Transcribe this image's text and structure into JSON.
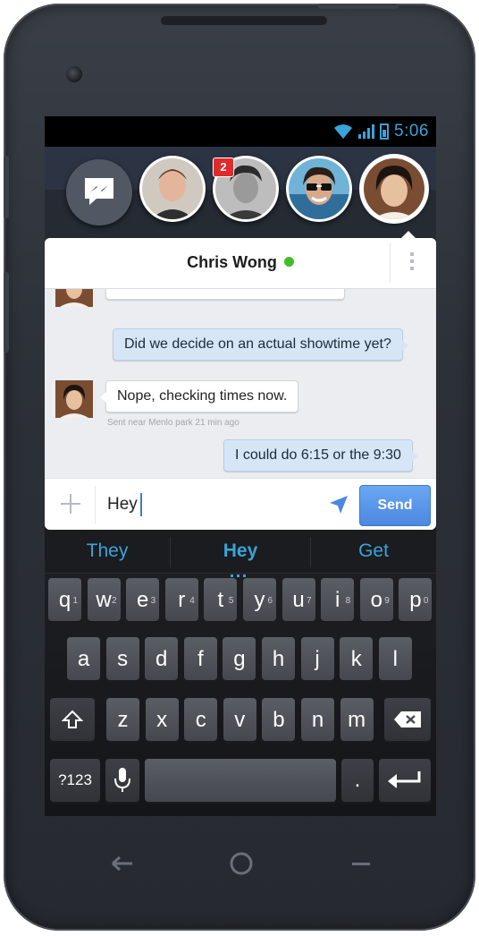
{
  "status_bar": {
    "time": "5:06"
  },
  "chat_heads": {
    "badge_count": "2",
    "people": [
      "person-1",
      "person-2",
      "person-3",
      "contact"
    ]
  },
  "conversation": {
    "contact_name": "Chris Wong",
    "messages": [
      {
        "direction": "out",
        "text": "Did we decide on an actual showtime yet?"
      },
      {
        "direction": "in",
        "text": "Nope, checking times now.",
        "meta": "Sent near Menlo park 21 min ago"
      },
      {
        "direction": "out",
        "text": "I could do 6:15 or the 9:30"
      }
    ],
    "composer": {
      "value": "Hey",
      "send_label": "Send"
    }
  },
  "keyboard": {
    "suggestions": [
      "They",
      "Hey",
      "Get"
    ],
    "row1": [
      {
        "k": "q",
        "h": "1"
      },
      {
        "k": "w",
        "h": "2"
      },
      {
        "k": "e",
        "h": "3"
      },
      {
        "k": "r",
        "h": "4"
      },
      {
        "k": "t",
        "h": "5"
      },
      {
        "k": "y",
        "h": "6"
      },
      {
        "k": "u",
        "h": "7"
      },
      {
        "k": "i",
        "h": "8"
      },
      {
        "k": "o",
        "h": "9"
      },
      {
        "k": "p",
        "h": "0"
      }
    ],
    "row2": [
      "a",
      "s",
      "d",
      "f",
      "g",
      "h",
      "j",
      "k",
      "l"
    ],
    "row3": [
      "z",
      "x",
      "c",
      "v",
      "b",
      "n",
      "m"
    ],
    "symbols_label": "?123",
    "period_label": "."
  },
  "colors": {
    "accent": "#3aa3d9",
    "online": "#3fbf27",
    "send": "#4b88e0",
    "badge": "#e12a2a"
  }
}
